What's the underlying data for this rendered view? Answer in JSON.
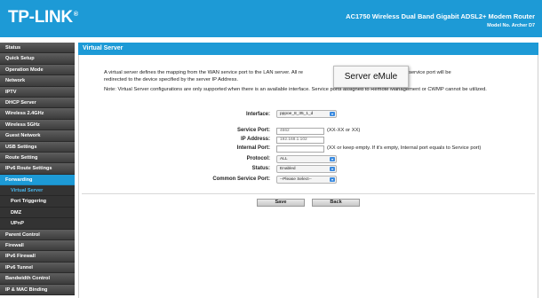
{
  "header": {
    "logo": "TP-LINK",
    "logo_mark": "®",
    "product_name": "AC1750 Wireless Dual Band Gigabit ADSL2+ Modem Router",
    "model": "Model No. Archer D7",
    "background_color": "#1d9ad6"
  },
  "sidebar": {
    "items_top": [
      {
        "label": "Status"
      },
      {
        "label": "Quick Setup"
      },
      {
        "label": "Operation Mode"
      },
      {
        "label": "Network"
      },
      {
        "label": "IPTV"
      },
      {
        "label": "DHCP Server"
      },
      {
        "label": "Wireless 2.4GHz"
      },
      {
        "label": "Wireless 5GHz"
      },
      {
        "label": "Guest Network"
      },
      {
        "label": "USB Settings"
      },
      {
        "label": "Route Setting"
      },
      {
        "label": "IPv6 Route Settings"
      },
      {
        "label": "Forwarding"
      }
    ],
    "sub_items": [
      {
        "label": "Virtual Server"
      },
      {
        "label": "Port Triggering"
      },
      {
        "label": "DMZ"
      },
      {
        "label": "UPnP"
      }
    ],
    "items_bottom": [
      {
        "label": "Parent Control"
      },
      {
        "label": "Firewall"
      },
      {
        "label": "IPv6 Firewall"
      },
      {
        "label": "IPv6 Tunnel"
      },
      {
        "label": "Bandwidth Control"
      },
      {
        "label": "IP & MAC Binding"
      }
    ],
    "active_color": "#1d9ad6",
    "current_sub_color": "#4ab8ee"
  },
  "main": {
    "title": "Virtual Server",
    "description": "A virtual server defines the mapping from the WAN service port to the LAN server. All re",
    "description_tail": "he designated service port will be",
    "description_line2": "redirected to the device specified by the server IP Address.",
    "note": "Note: Virtual Server configurations are only supported when there is an available interface. Service ports assigned to Remote Management or CWMP cannot be utilized.",
    "form": {
      "interface_label": "Interface:",
      "interface_value": "pppoe_8_35_1_d",
      "service_port_label": "Service Port:",
      "service_port_value": "4662",
      "service_port_hint": "(XX-XX or XX)",
      "ip_address_label": "IP Address:",
      "ip_address_value": "192.168.1.102",
      "internal_port_label": "Internal Port:",
      "internal_port_value": "",
      "internal_port_hint": "(XX or keep empty. If it's empty, Internal port equals to Service port)",
      "protocol_label": "Protocol:",
      "protocol_value": "ALL",
      "status_label": "Status:",
      "status_value": "Enabled",
      "common_port_label": "Common Service Port:",
      "common_port_value": "--Please Select--"
    },
    "save_label": "Save",
    "back_label": "Back"
  },
  "tooltip": {
    "text": "Server eMule"
  }
}
